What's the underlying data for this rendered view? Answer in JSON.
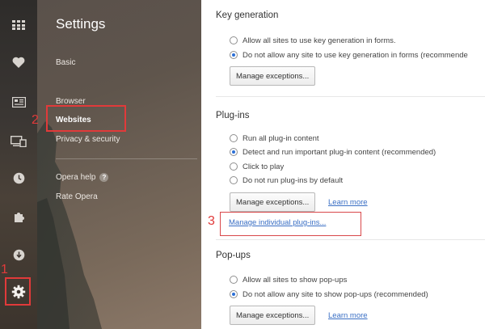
{
  "iconbar": {
    "icons": [
      "speed-dial-icon",
      "heart-icon",
      "news-icon",
      "tabs-sync-icon",
      "history-icon",
      "extensions-icon",
      "downloads-icon",
      "settings-gear-icon"
    ]
  },
  "sidebar": {
    "title": "Settings",
    "items": {
      "basic": "Basic",
      "browser": "Browser",
      "websites": "Websites",
      "privacy": "Privacy & security",
      "help": "Opera help",
      "help_icon": "?",
      "rate": "Rate Opera"
    }
  },
  "annotations": {
    "n1": "1",
    "n2": "2",
    "n3": "3",
    "color": "#e13a3a"
  },
  "keygen": {
    "heading": "Key generation",
    "opt1": "Allow all sites to use key generation in forms.",
    "opt2": "Do not allow any site to use key generation in forms (recommende",
    "selected": 2,
    "manage": "Manage exceptions..."
  },
  "plugins": {
    "heading": "Plug-ins",
    "opt1": "Run all plug-in content",
    "opt2": "Detect and run important plug-in content (recommended)",
    "opt3": "Click to play",
    "opt4": "Do not run plug-ins by default",
    "selected": 2,
    "manage": "Manage exceptions...",
    "learn": "Learn more",
    "individual": "Manage individual plug-ins..."
  },
  "popups": {
    "heading": "Pop-ups",
    "opt1": "Allow all sites to show pop-ups",
    "opt2": "Do not allow any site to show pop-ups (recommended)",
    "selected": 2,
    "manage": "Manage exceptions...",
    "learn": "Learn more"
  }
}
